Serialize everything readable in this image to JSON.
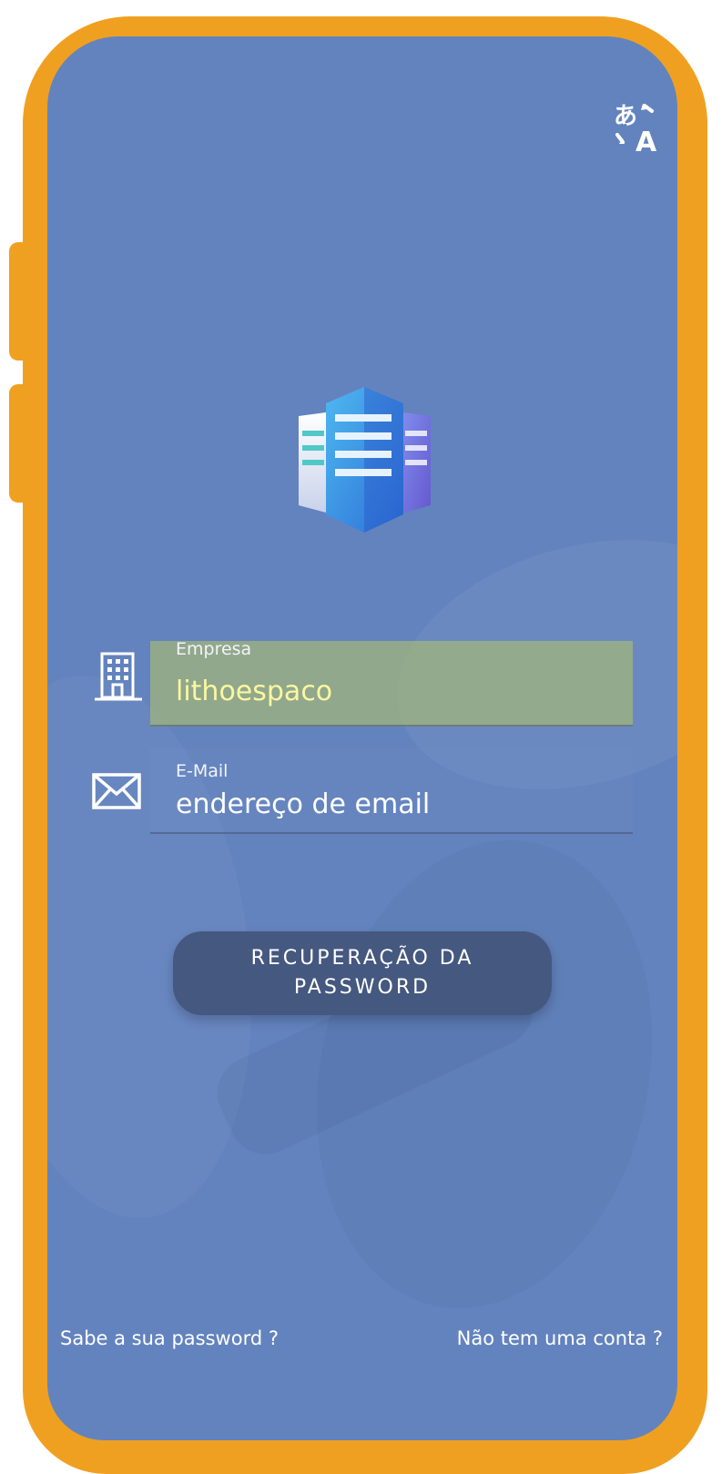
{
  "top_bar": {
    "translate_icon": "translate-icon"
  },
  "logo": {
    "icon": "building-logo-icon"
  },
  "form": {
    "company": {
      "icon": "office-building-icon",
      "label": "Empresa",
      "value": "lithoespaco"
    },
    "email": {
      "icon": "envelope-icon",
      "label": "E-Mail",
      "placeholder": "endereço de email"
    }
  },
  "actions": {
    "recover_line1": "RECUPERAÇÃO DA",
    "recover_line2": "PASSWORD"
  },
  "footer": {
    "know_password": "Sabe a sua password ?",
    "no_account": "Não tem uma conta ?"
  },
  "colors": {
    "frame": "#f0a020",
    "background": "#6383be",
    "button": "#45587f",
    "company_field_highlight": "#afbe6e",
    "company_value_text": "#fbf7a0"
  }
}
